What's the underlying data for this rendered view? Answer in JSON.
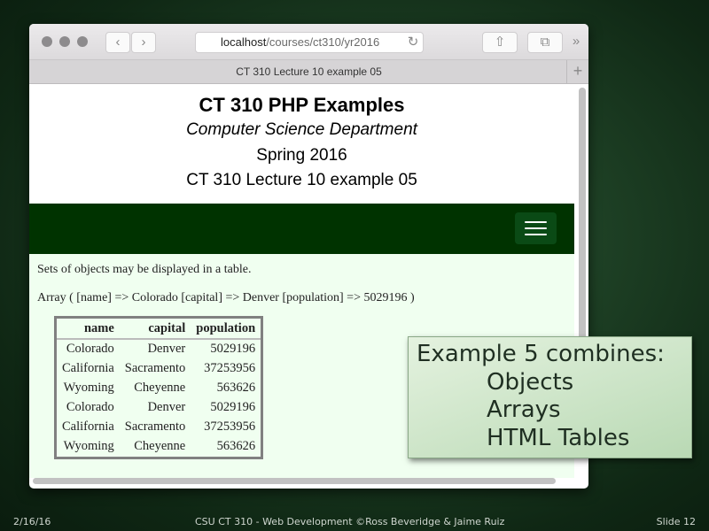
{
  "browser": {
    "url_host": "localhost",
    "url_path": "/courses/ct310/yr2016",
    "tab_title": "CT 310 Lecture 10 example 05",
    "back_icon": "‹",
    "forward_icon": "›",
    "reload_icon": "↻",
    "share_icon": "⇧",
    "tabs_icon": "⧉",
    "more_icon": "»",
    "new_tab_icon": "+"
  },
  "page": {
    "title": "CT 310 PHP Examples",
    "department": "Computer Science Department",
    "term": "Spring 2016",
    "lecture": "CT 310 Lecture 10 example 05",
    "intro": "Sets of objects may be displayed in a table.",
    "array_dump": "Array ( [name] => Colorado [capital] => Denver [population] => 5029196 )",
    "table": {
      "headers": [
        "name",
        "capital",
        "population"
      ],
      "rows": [
        [
          "Colorado",
          "Denver",
          "5029196"
        ],
        [
          "California",
          "Sacramento",
          "37253956"
        ],
        [
          "Wyoming",
          "Cheyenne",
          "563626"
        ],
        [
          "Colorado",
          "Denver",
          "5029196"
        ],
        [
          "California",
          "Sacramento",
          "37253956"
        ],
        [
          "Wyoming",
          "Cheyenne",
          "563626"
        ]
      ]
    },
    "nav_color": "#003300",
    "body_bg": "#f0fff0"
  },
  "callout": {
    "heading": "Example 5 combines:",
    "items": [
      "Objects",
      "Arrays",
      "HTML Tables"
    ]
  },
  "footer": {
    "date": "2/16/16",
    "center": "CSU CT 310 - Web Development ©Ross Beveridge & Jaime Ruiz",
    "slide": "Slide 12"
  }
}
